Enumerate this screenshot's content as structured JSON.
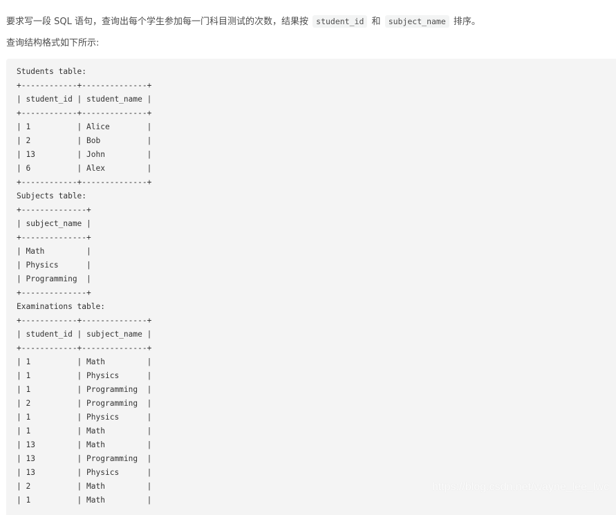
{
  "intro": {
    "text_before": "要求写一段 SQL 语句，查询出每个学生参加每一门科目测试的次数，结果按",
    "code1": "student_id",
    "text_between": "和",
    "code2": "subject_name",
    "text_after": "排序。"
  },
  "format_note": "查询结构格式如下所示:",
  "code_block": {
    "lines": [
      "Students table:",
      "+------------+--------------+",
      "| student_id | student_name |",
      "+------------+--------------+",
      "| 1          | Alice        |",
      "| 2          | Bob          |",
      "| 13         | John         |",
      "| 6          | Alex         |",
      "+------------+--------------+",
      "Subjects table:",
      "+--------------+",
      "| subject_name |",
      "+--------------+",
      "| Math         |",
      "| Physics      |",
      "| Programming  |",
      "+--------------+",
      "Examinations table:",
      "+------------+--------------+",
      "| student_id | subject_name |",
      "+------------+--------------+",
      "| 1          | Math         |",
      "| 1          | Physics      |",
      "| 1          | Programming  |",
      "| 2          | Programming  |",
      "| 1          | Physics      |",
      "| 1          | Math         |",
      "| 13         | Math         |",
      "| 13         | Programming  |",
      "| 13         | Physics      |",
      "| 2          | Math         |",
      "| 1          | Math         |"
    ]
  },
  "tables": {
    "students": {
      "title": "Students table:",
      "columns": [
        "student_id",
        "student_name"
      ],
      "rows": [
        [
          "1",
          "Alice"
        ],
        [
          "2",
          "Bob"
        ],
        [
          "13",
          "John"
        ],
        [
          "6",
          "Alex"
        ]
      ]
    },
    "subjects": {
      "title": "Subjects table:",
      "columns": [
        "subject_name"
      ],
      "rows": [
        [
          "Math"
        ],
        [
          "Physics"
        ],
        [
          "Programming"
        ]
      ]
    },
    "examinations": {
      "title": "Examinations table:",
      "columns": [
        "student_id",
        "subject_name"
      ],
      "rows": [
        [
          "1",
          "Math"
        ],
        [
          "1",
          "Physics"
        ],
        [
          "1",
          "Programming"
        ],
        [
          "2",
          "Programming"
        ],
        [
          "1",
          "Physics"
        ],
        [
          "1",
          "Math"
        ],
        [
          "13",
          "Math"
        ],
        [
          "13",
          "Programming"
        ],
        [
          "13",
          "Physics"
        ],
        [
          "2",
          "Math"
        ],
        [
          "1",
          "Math"
        ]
      ]
    }
  },
  "watermark": "https://blog.csdn.net/wayne_lee_lwc"
}
